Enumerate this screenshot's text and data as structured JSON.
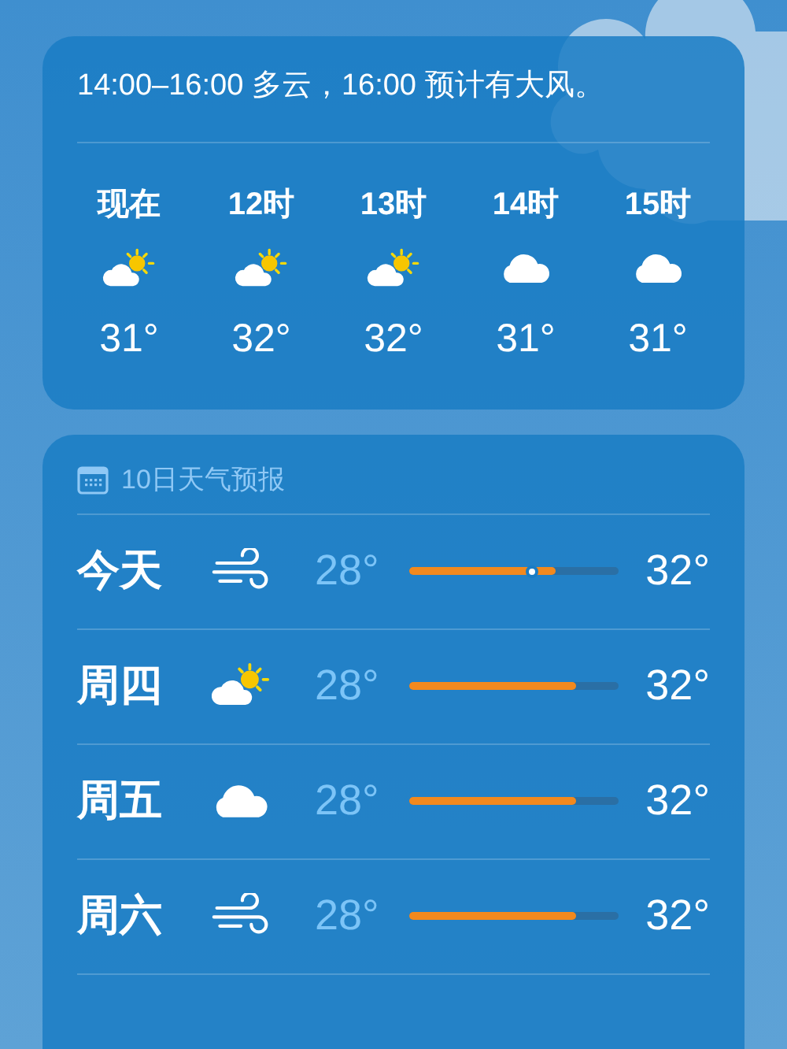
{
  "hourly": {
    "summary": "14:00–16:00 多云，16:00 预计有大风。",
    "hours": [
      {
        "label": "现在",
        "kind": "partly_sunny",
        "temp": "31°"
      },
      {
        "label": "12时",
        "kind": "partly_sunny",
        "temp": "32°"
      },
      {
        "label": "13时",
        "kind": "partly_sunny",
        "temp": "32°"
      },
      {
        "label": "14时",
        "kind": "cloudy",
        "temp": "31°"
      },
      {
        "label": "15时",
        "kind": "cloudy",
        "temp": "31°"
      }
    ]
  },
  "forecast": {
    "title": "10日天气预报",
    "days": [
      {
        "day": "今天",
        "kind": "wind",
        "low": "28°",
        "high": "32°",
        "level": 0.7,
        "current": {
          "level": 0.59
        }
      },
      {
        "day": "周四",
        "kind": "partly_sunny",
        "low": "28°",
        "high": "32°",
        "level": 0.8
      },
      {
        "day": "周五",
        "kind": "cloudy",
        "low": "28°",
        "high": "32°",
        "level": 0.8
      },
      {
        "day": "周六",
        "kind": "wind",
        "low": "28°",
        "high": "32°",
        "level": 0.8
      }
    ]
  }
}
